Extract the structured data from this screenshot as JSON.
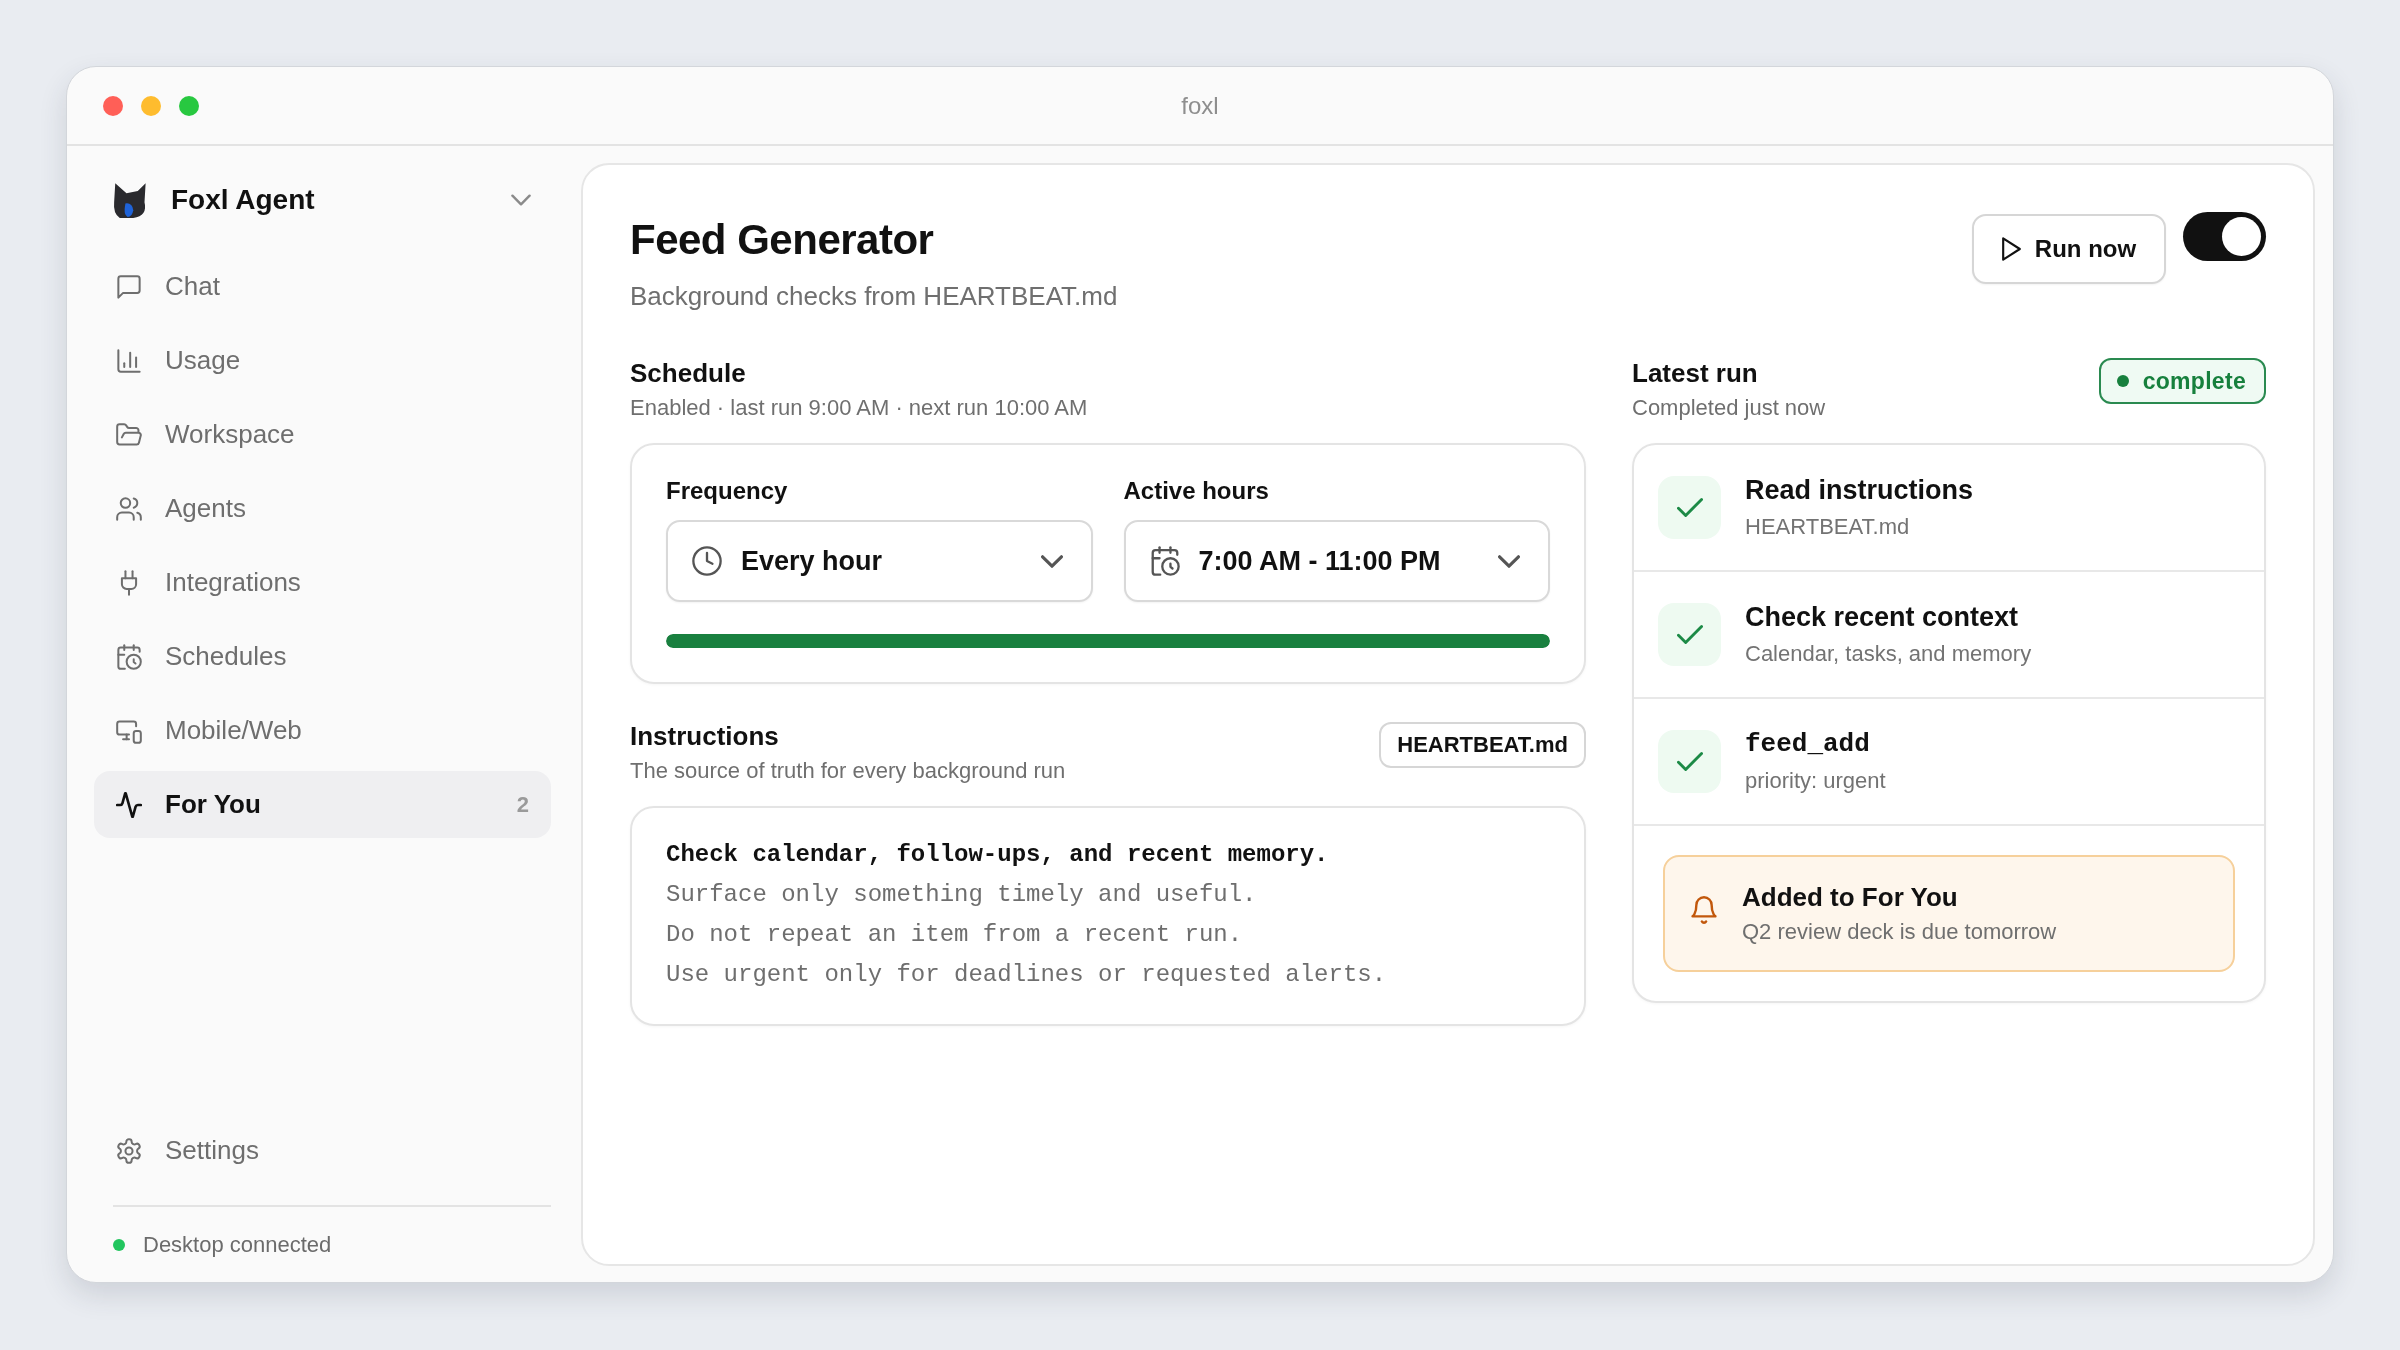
{
  "window": {
    "title": "foxl"
  },
  "sidebar": {
    "workspace": "Foxl Agent",
    "items": [
      {
        "label": "Chat",
        "selected": false
      },
      {
        "label": "Usage",
        "selected": false
      },
      {
        "label": "Workspace",
        "selected": false
      },
      {
        "label": "Agents",
        "selected": false
      },
      {
        "label": "Integrations",
        "selected": false
      },
      {
        "label": "Schedules",
        "selected": false
      },
      {
        "label": "Mobile/Web",
        "selected": false
      },
      {
        "label": "For You",
        "selected": true,
        "count": "2"
      }
    ],
    "settings": "Settings",
    "status": {
      "label": "Desktop connected",
      "connected": true
    }
  },
  "header": {
    "title": "Feed Generator",
    "subtitle": "Background checks from HEARTBEAT.md",
    "run_button": "Run now",
    "enabled": true
  },
  "schedule": {
    "title": "Schedule",
    "subtitle": "Enabled · last run 9:00 AM · next run 10:00 AM",
    "fields": [
      {
        "label": "Frequency",
        "value": "Every hour"
      },
      {
        "label": "Active hours",
        "value": "7:00 AM - 11:00 PM"
      }
    ],
    "progress": {
      "level": 1
    }
  },
  "instructions": {
    "title": "Instructions",
    "subtitle": "The source of truth for every background run",
    "file_button": "HEARTBEAT.md",
    "lines": [
      {
        "text": "Check calendar, follow-ups, and recent memory.",
        "kind": "heading"
      },
      {
        "text": "Surface only something timely and useful.",
        "kind": "body"
      },
      {
        "text": "Do not repeat an item from a recent run.",
        "kind": "body"
      },
      {
        "text": "Use urgent only for deadlines or requested alerts.",
        "kind": "body"
      }
    ]
  },
  "latest_run": {
    "title": "Latest run",
    "subtitle": "Completed just now",
    "status": "complete",
    "steps": [
      {
        "title": "Read instructions",
        "detail": "HEARTBEAT.md",
        "kind": "step",
        "done": true
      },
      {
        "title": "Check recent context",
        "detail": "Calendar, tasks, and memory",
        "kind": "step",
        "done": true
      },
      {
        "title": "feed_add",
        "detail": "priority: urgent",
        "kind": "tool",
        "done": true
      }
    ],
    "notice": {
      "title": "Added to For You",
      "text": "Q2 review deck is due tomorrow"
    }
  }
}
